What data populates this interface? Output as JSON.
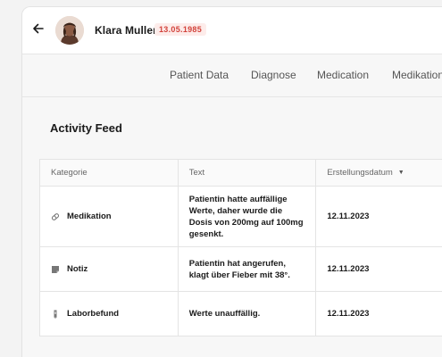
{
  "header": {
    "patient_name": "Klara Muller",
    "birthdate": "13.05.1985"
  },
  "tabs": [
    {
      "label": "Patient Data"
    },
    {
      "label": "Diagnose"
    },
    {
      "label": "Medication"
    },
    {
      "label": "Medikation"
    }
  ],
  "feed": {
    "title": "Activity Feed",
    "columns": [
      "Kategorie",
      "Text",
      "Erstellungsdatum"
    ],
    "rows": [
      {
        "category": "Medikation",
        "icon": "pill-icon",
        "text": "Patientin hatte auffällige Werte, daher wurde die Dosis von 200mg auf 100mg gesenkt.",
        "date": "12.11.2023"
      },
      {
        "category": "Notiz",
        "icon": "note-icon",
        "text": "Patientin hat angerufen, klagt über Fieber mit 38°.",
        "date": "12.11.2023"
      },
      {
        "category": "Laborbefund",
        "icon": "test-tube-icon",
        "text": "Werte unauffällig.",
        "date": "12.11.2023"
      }
    ]
  },
  "colors": {
    "accent_red": "#d2423b",
    "badge_bg": "#fdecea"
  }
}
